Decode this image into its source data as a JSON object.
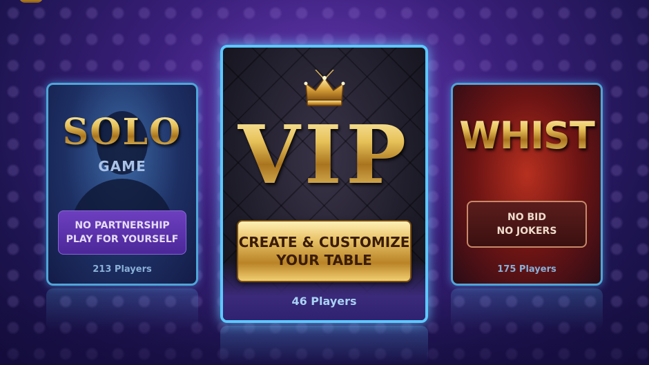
{
  "cards": {
    "solo": {
      "title": "SOLO",
      "subtitle": "GAME",
      "button_line1": "NO PARTNERSHIP",
      "button_line2": "PLAY FOR YOURSELF",
      "players": "213 Players"
    },
    "vip": {
      "title": "VIP",
      "button_line1": "CREATE & CUSTOMIZE",
      "button_line2": "YOUR TABLE",
      "players": "46 Players"
    },
    "whist": {
      "title": "WHIST",
      "button_line1": "NO BID",
      "button_line2": "NO JOKERS",
      "players": "175 Players"
    }
  },
  "icons": {
    "crown": "crown-icon",
    "silhouette": "player-silhouette-icon",
    "logo": "app-logo-icon"
  },
  "colors": {
    "side_card_border": "#4fa6d8",
    "vip_card_border": "#5cc8ff",
    "gold": "#e7c25a",
    "solo_button": "#6d3fc0",
    "whist_button": "#5a1d1c",
    "background": "#3a1f7a"
  }
}
